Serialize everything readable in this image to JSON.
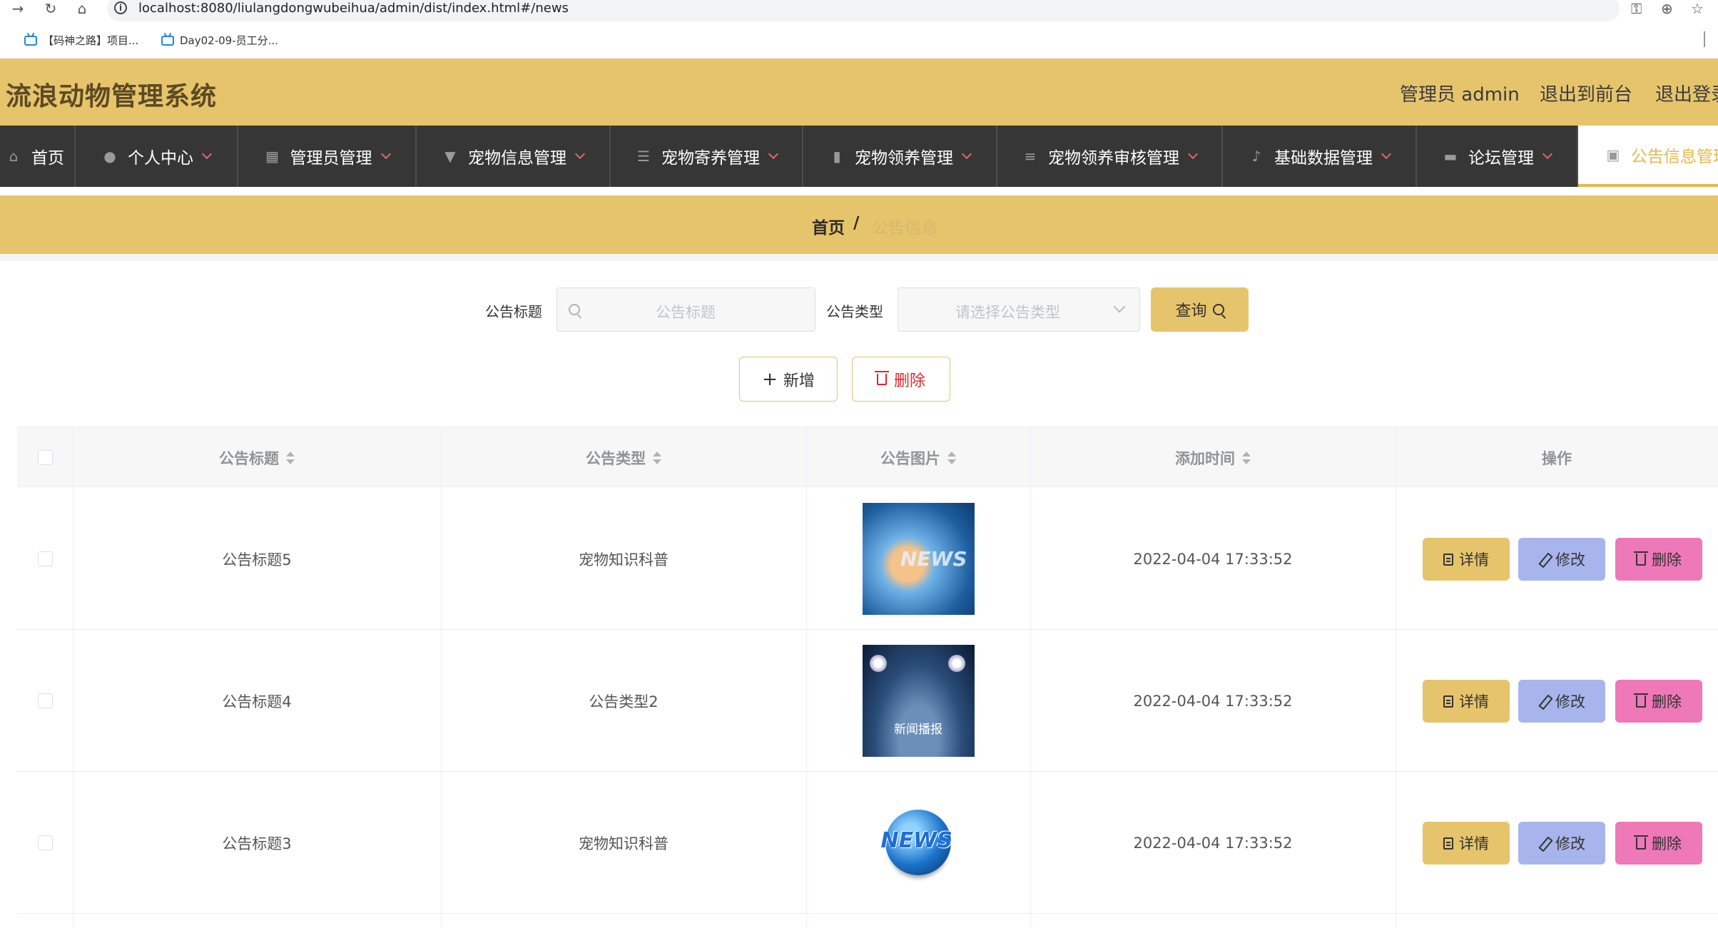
{
  "browser": {
    "url": "localhost:8080/liulangdongwubeihua/admin/dist/index.html#/news",
    "bookmarks": [
      "【码神之路】项目...",
      "Day02-09-员工分..."
    ]
  },
  "header": {
    "title": "流浪动物管理系统",
    "user": "管理员 admin",
    "to_front": "退出到前台",
    "logout": "退出登录"
  },
  "menu": [
    {
      "label": "首页",
      "icon": "home-icon"
    },
    {
      "label": "个人中心",
      "icon": "user-icon"
    },
    {
      "label": "管理员管理",
      "icon": "grid-icon"
    },
    {
      "label": "宠物信息管理",
      "icon": "brush-icon"
    },
    {
      "label": "宠物寄养管理",
      "icon": "sliders-icon"
    },
    {
      "label": "宠物领养管理",
      "icon": "chart-icon"
    },
    {
      "label": "宠物领养审核管理",
      "icon": "list-icon"
    },
    {
      "label": "基础数据管理",
      "icon": "mic-icon"
    },
    {
      "label": "论坛管理",
      "icon": "chat-icon"
    },
    {
      "label": "公告信息管理",
      "icon": "clipboard-icon"
    }
  ],
  "breadcrumb": {
    "home": "首页",
    "sep": "/",
    "current": "公告信息"
  },
  "search": {
    "title_label": "公告标题",
    "title_placeholder": "公告标题",
    "type_label": "公告类型",
    "type_placeholder": "请选择公告类型",
    "query_label": "查询"
  },
  "actions": {
    "add_label": "新增",
    "delete_label": "删除"
  },
  "table": {
    "headers": [
      "公告标题",
      "公告类型",
      "公告图片",
      "添加时间",
      "操作"
    ],
    "rows": [
      {
        "title": "公告标题5",
        "type": "宠物知识科普",
        "image": "news-image-1",
        "image_text": "NEWS",
        "time": "2022-04-04 17:33:52"
      },
      {
        "title": "公告标题4",
        "type": "公告类型2",
        "image": "news-image-2",
        "image_text": "新闻播报",
        "time": "2022-04-04 17:33:52"
      },
      {
        "title": "公告标题3",
        "type": "宠物知识科普",
        "image": "news-image-3",
        "image_text": "NEWS",
        "time": "2022-04-04 17:33:52"
      }
    ],
    "op_detail": "详情",
    "op_edit": "修改",
    "op_delete": "删除"
  },
  "colors": {
    "accent": "#e6c46c",
    "menu_bg": "#363636",
    "edit_btn": "#a8b5ec",
    "delete_btn": "#ef78b8",
    "danger_text": "#e0282e"
  }
}
